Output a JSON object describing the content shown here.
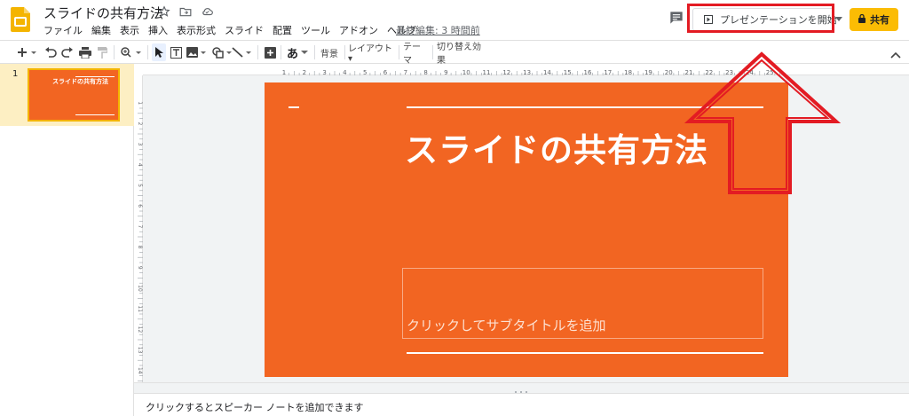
{
  "app": {
    "doc_title": "スライドの共有方法",
    "last_edit": "最終編集: 3 時間前",
    "brand_color": "#fbbc04"
  },
  "menu": {
    "items": [
      "ファイル",
      "編集",
      "表示",
      "挿入",
      "表示形式",
      "スライド",
      "配置",
      "ツール",
      "アドオン",
      "ヘルプ"
    ]
  },
  "header": {
    "present_label": "プレゼンテーションを開始",
    "share_label": "共有"
  },
  "toolbar": {
    "background_label": "背景",
    "layout_label": "レイアウト▾",
    "theme_label": "テーマ",
    "transition_label": "切り替え効果",
    "text_label": "あ"
  },
  "ruler": {
    "horizontal": [
      "1",
      "2",
      "3",
      "4",
      "5",
      "6",
      "7",
      "8",
      "9",
      "10",
      "11",
      "12",
      "13",
      "14",
      "15",
      "16",
      "17",
      "18",
      "19",
      "20",
      "21",
      "22",
      "23",
      "24",
      "25"
    ],
    "vertical": [
      "1",
      "2",
      "3",
      "4",
      "5",
      "6",
      "7",
      "8",
      "9",
      "10",
      "11",
      "12",
      "13",
      "14"
    ]
  },
  "filmstrip": {
    "slides": [
      {
        "number": "1",
        "title": "スライドの共有方法"
      }
    ]
  },
  "slide": {
    "title": "スライドの共有方法",
    "subtitle_placeholder": "クリックしてサブタイトルを追加",
    "background_color": "#f26522"
  },
  "notes": {
    "placeholder": "クリックするとスピーカー ノートを追加できます"
  },
  "annotation": {
    "highlight_color": "#e31b23"
  }
}
